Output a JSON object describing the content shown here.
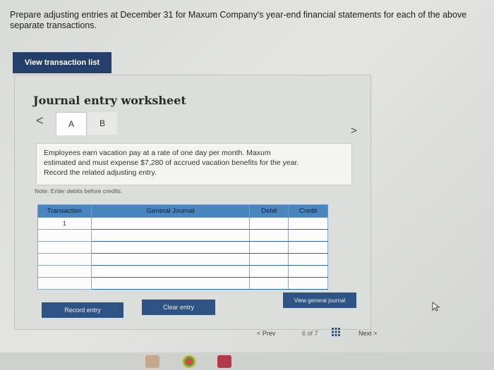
{
  "instructions": "Prepare adjusting entries at December 31 for Maxum Company's year-end financial statements for each of the above separate transactions.",
  "view_transaction_list_label": "View transaction list",
  "worksheet": {
    "title": "Journal entry worksheet",
    "tabs": [
      "A",
      "B"
    ],
    "prev_arrow": "<",
    "next_arrow": ">",
    "description": [
      "Employees earn vacation pay at a rate of one day per month. Maxum",
      "estimated and must expense $7,280 of accrued vacation benefits for the year.",
      "Record the related adjusting entry."
    ],
    "note": "Note: Enter debits before credits.",
    "table": {
      "headers": [
        "Transaction",
        "General Journal",
        "Debit",
        "Credit"
      ],
      "rows": [
        [
          "1",
          "",
          "",
          ""
        ],
        [
          "",
          "",
          "",
          ""
        ],
        [
          "",
          "",
          "",
          ""
        ],
        [
          "",
          "",
          "",
          ""
        ],
        [
          "",
          "",
          "",
          ""
        ],
        [
          "",
          "",
          "",
          ""
        ]
      ]
    },
    "buttons": {
      "record": "Record entry",
      "clear": "Clear entry",
      "view_general_journal": "View general journal"
    }
  },
  "pager": {
    "prev": "< Prev",
    "count": "6 of 7",
    "next": "Next >"
  },
  "colors": {
    "header_blue": "#4b85c0",
    "button_navy": "#2d5485"
  }
}
